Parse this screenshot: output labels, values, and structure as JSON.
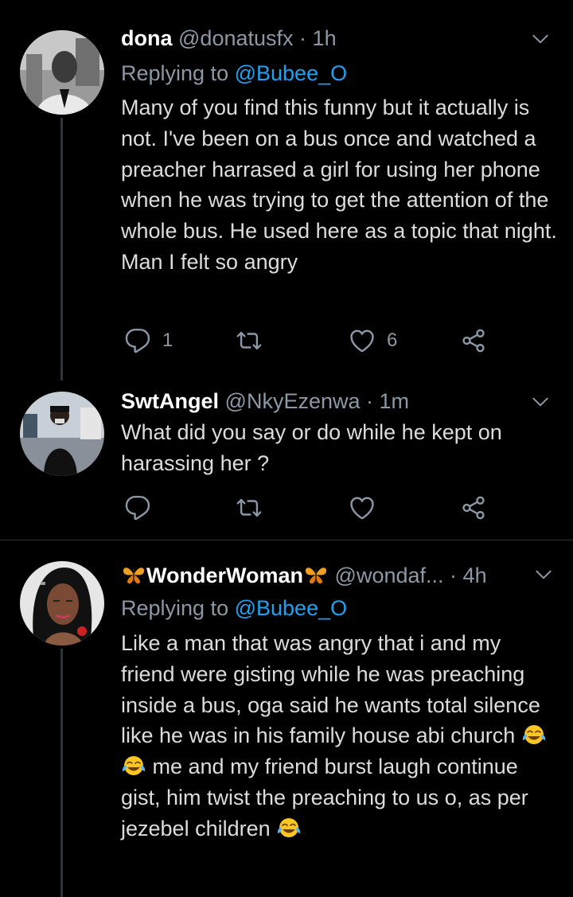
{
  "tweets": [
    {
      "name": "dona",
      "handle": "@donatusfx",
      "time": "1h",
      "replying_prefix": "Replying to",
      "replying_to": "@Bubee_O",
      "text": "Many of you find this funny but it actually is not. I've been on a bus once and watched a preacher harrased a girl for using her phone when he was trying to get the attention of the whole bus. He used here as a topic that night. Man I felt so angry",
      "reply_count": "1",
      "retweet_count": "",
      "like_count": "6"
    },
    {
      "name": "SwtAngel",
      "handle": "@NkyEzenwa",
      "time": "1m",
      "text": "What did you say or do while he kept on harassing her ?",
      "reply_count": "",
      "retweet_count": "",
      "like_count": ""
    },
    {
      "name": "WonderWoman",
      "handle": "@wondaf...",
      "time": "4h",
      "replying_prefix": "Replying to",
      "replying_to": "@Bubee_O",
      "text_part1": "Like a man that was angry that i and my friend were gisting while he was preaching inside a bus, oga said he wants total silence like he was in his family house abi church",
      "text_part2": "me and my friend burst laugh continue gist, him twist the preaching to us o, as per jezebel children",
      "name_emoji": "butterfly",
      "body_emoji": "face-with-tears-of-joy"
    }
  ],
  "colors": {
    "background": "#000000",
    "name": "#ffffff",
    "secondary": "#8b98a5",
    "link": "#1da1f2",
    "divider": "#2f3336"
  }
}
